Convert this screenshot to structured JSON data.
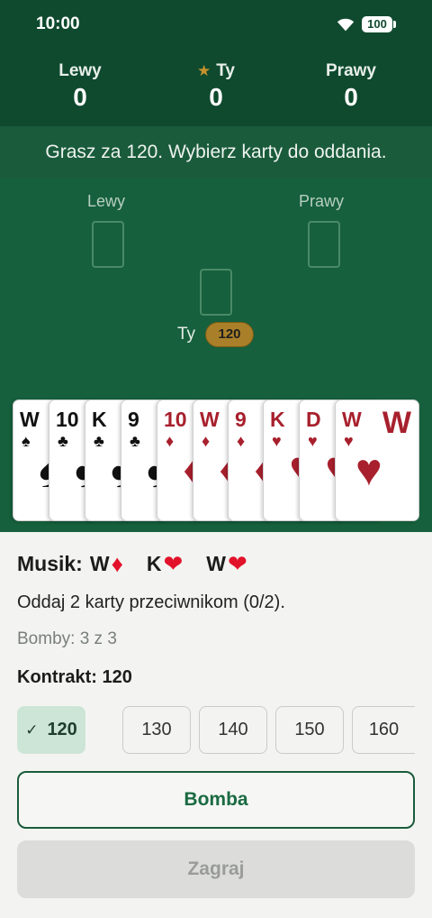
{
  "status_bar": {
    "time": "10:00",
    "battery": "100"
  },
  "scores": [
    {
      "name": "Lewy",
      "value": "0",
      "is_you": false
    },
    {
      "name": "Ty",
      "value": "0",
      "is_you": true
    },
    {
      "name": "Prawy",
      "value": "0",
      "is_you": false
    }
  ],
  "banner": "Grasz za 120. Wybierz karty do oddania.",
  "table": {
    "left_label": "Lewy",
    "right_label": "Prawy",
    "you_label": "Ty",
    "you_bid": "120"
  },
  "hand": [
    {
      "rank": "W",
      "suit": "♠",
      "color": "black"
    },
    {
      "rank": "10",
      "suit": "♣",
      "color": "black"
    },
    {
      "rank": "K",
      "suit": "♣",
      "color": "black"
    },
    {
      "rank": "9",
      "suit": "♣",
      "color": "black"
    },
    {
      "rank": "10",
      "suit": "♦",
      "color": "red"
    },
    {
      "rank": "W",
      "suit": "♦",
      "color": "red"
    },
    {
      "rank": "9",
      "suit": "♦",
      "color": "red"
    },
    {
      "rank": "K",
      "suit": "♥",
      "color": "red"
    },
    {
      "rank": "D",
      "suit": "♥",
      "color": "red"
    },
    {
      "rank": "W",
      "suit": "♥",
      "color": "red"
    }
  ],
  "panel": {
    "musik_label": "Musik:",
    "musik_cards": [
      {
        "rank": "W",
        "suit": "♦"
      },
      {
        "rank": "K",
        "suit": "❤"
      },
      {
        "rank": "W",
        "suit": "❤"
      }
    ],
    "instruction": "Oddaj 2 karty przeciwnikom (0/2).",
    "bomby": "Bomby: 3 z 3",
    "kontrakt": "Kontrakt: 120",
    "bids": [
      {
        "value": "120",
        "selected": true
      },
      {
        "value": "130",
        "selected": false
      },
      {
        "value": "140",
        "selected": false
      },
      {
        "value": "150",
        "selected": false
      },
      {
        "value": "160",
        "selected": false
      }
    ],
    "bomba_label": "Bomba",
    "zagraj_label": "Zagraj"
  },
  "colors": {
    "header": "#0f4a2f",
    "table": "#16603d",
    "accent": "#1a5b3b",
    "gold": "#a98029",
    "red_suit": "#a8202d"
  }
}
